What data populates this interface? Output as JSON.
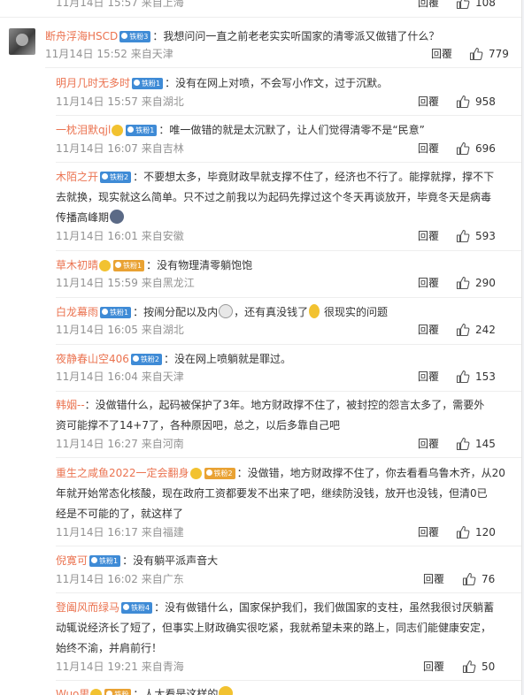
{
  "top": {
    "meta": "11月14日 15:57 来自上海",
    "reply": "回覆",
    "likes": "108"
  },
  "main": {
    "username": "断舟浮海HSCD",
    "badge": "铁粉3",
    "text": "：我想问问一直之前老老实实听国家的清零派又做错了什么？",
    "meta": "11月14日 15:52 来自天津",
    "reply": "回覆",
    "likes": "779"
  },
  "replies": [
    {
      "username": "明月几时无多时",
      "badge": "铁粉1",
      "lines": [
        "：没有在网上对喷，不会写小作文，过于沉默。"
      ],
      "meta": "11月14日 15:57 来自湖北",
      "reply": "回覆",
      "likes": "958"
    },
    {
      "username": "一枕泪默qjl",
      "badge": "铁粉1",
      "lines": [
        "：唯一做错的就是太沉默了，让人们觉得清零不是“民意”"
      ],
      "meta": "11月14日 16:07 来自吉林",
      "reply": "回覆",
      "likes": "696"
    },
    {
      "username": "木陌之开",
      "badge": "铁粉2",
      "lines": [
        "：不要想太多，毕竟财政早就支撑不住了，经济也不行了。能撑就撑，撑不下",
        "去就换，现实就这么简单。只不过之前我以为起码先撑过这个冬天再谈放开，毕竟冬天是病毒",
        "传播高峰期"
      ],
      "meta": "11月14日 16:01 来自安徽",
      "reply": "回覆",
      "likes": "593"
    },
    {
      "username": "草木初晴",
      "badge": "铁粉1",
      "lines": [
        "：没有物理清零躺饱饱"
      ],
      "meta": "11月14日 15:59 来自黑龙江",
      "reply": "回覆",
      "likes": "290"
    },
    {
      "username": "白龙幕雨",
      "badge": "铁粉1",
      "lines": [
        "：按闹分配以及内",
        "，还有真没钱了",
        " 很现实的问题"
      ],
      "meta": "11月14日 16:05 来自湖北",
      "reply": "回覆",
      "likes": "242"
    },
    {
      "username": "夜静春山空406",
      "badge": "铁粉2",
      "lines": [
        "：没在网上喷躺就是罪过。"
      ],
      "meta": "11月14日 16:04 来自天津",
      "reply": "回覆",
      "likes": "153"
    },
    {
      "username": "韩姻--",
      "badge": "",
      "lines": [
        "：没做错什么，起码被保护了3年。地方财政撑不住了，被封控的怨言太多了，需要外",
        "资可能撑不了14+7了，各种原因吧，总之，以后多靠自己吧"
      ],
      "meta": "11月14日 16:27 来自河南",
      "reply": "回覆",
      "likes": "145"
    },
    {
      "username": "重生之咸鱼2022一定会翻身",
      "badge": "铁粉2",
      "lines": [
        "：没做错，地方财政撑不住了，你去看看乌鲁木齐，从20",
        "年就开始常态化核酸，现在政府工资都要发不出来了吧，继续防没钱，放开也没钱，但清0已",
        "经是不可能的了，就这样了"
      ],
      "meta": "11月14日 16:17 来自福建",
      "reply": "回覆",
      "likes": "120"
    },
    {
      "username": "倪寛可",
      "badge": "铁粉1",
      "lines": [
        "：没有躺平派声音大"
      ],
      "meta": "11月14日 16:02 来自广东",
      "reply": "回覆",
      "likes": "76"
    },
    {
      "username": "登阖风而绿马",
      "badge": "铁粉4",
      "lines": [
        "：没有做错什么，国家保护我们，我们做国家的支柱，虽然我很讨厌躺蓄",
        "动辄说经济长了短了，但事实上财政确实很吃紧，我就希望未来的路上，同志们能健康安定，",
        "始终不渝，并肩前行！"
      ],
      "meta": "11月14日 19:21 来自青海",
      "reply": "回覆",
      "likes": "50"
    },
    {
      "username": "Wuo男",
      "badge": "铁粉",
      "lines": [
        "：人太看是这样的"
      ],
      "meta": "",
      "reply": "",
      "likes": ""
    }
  ]
}
